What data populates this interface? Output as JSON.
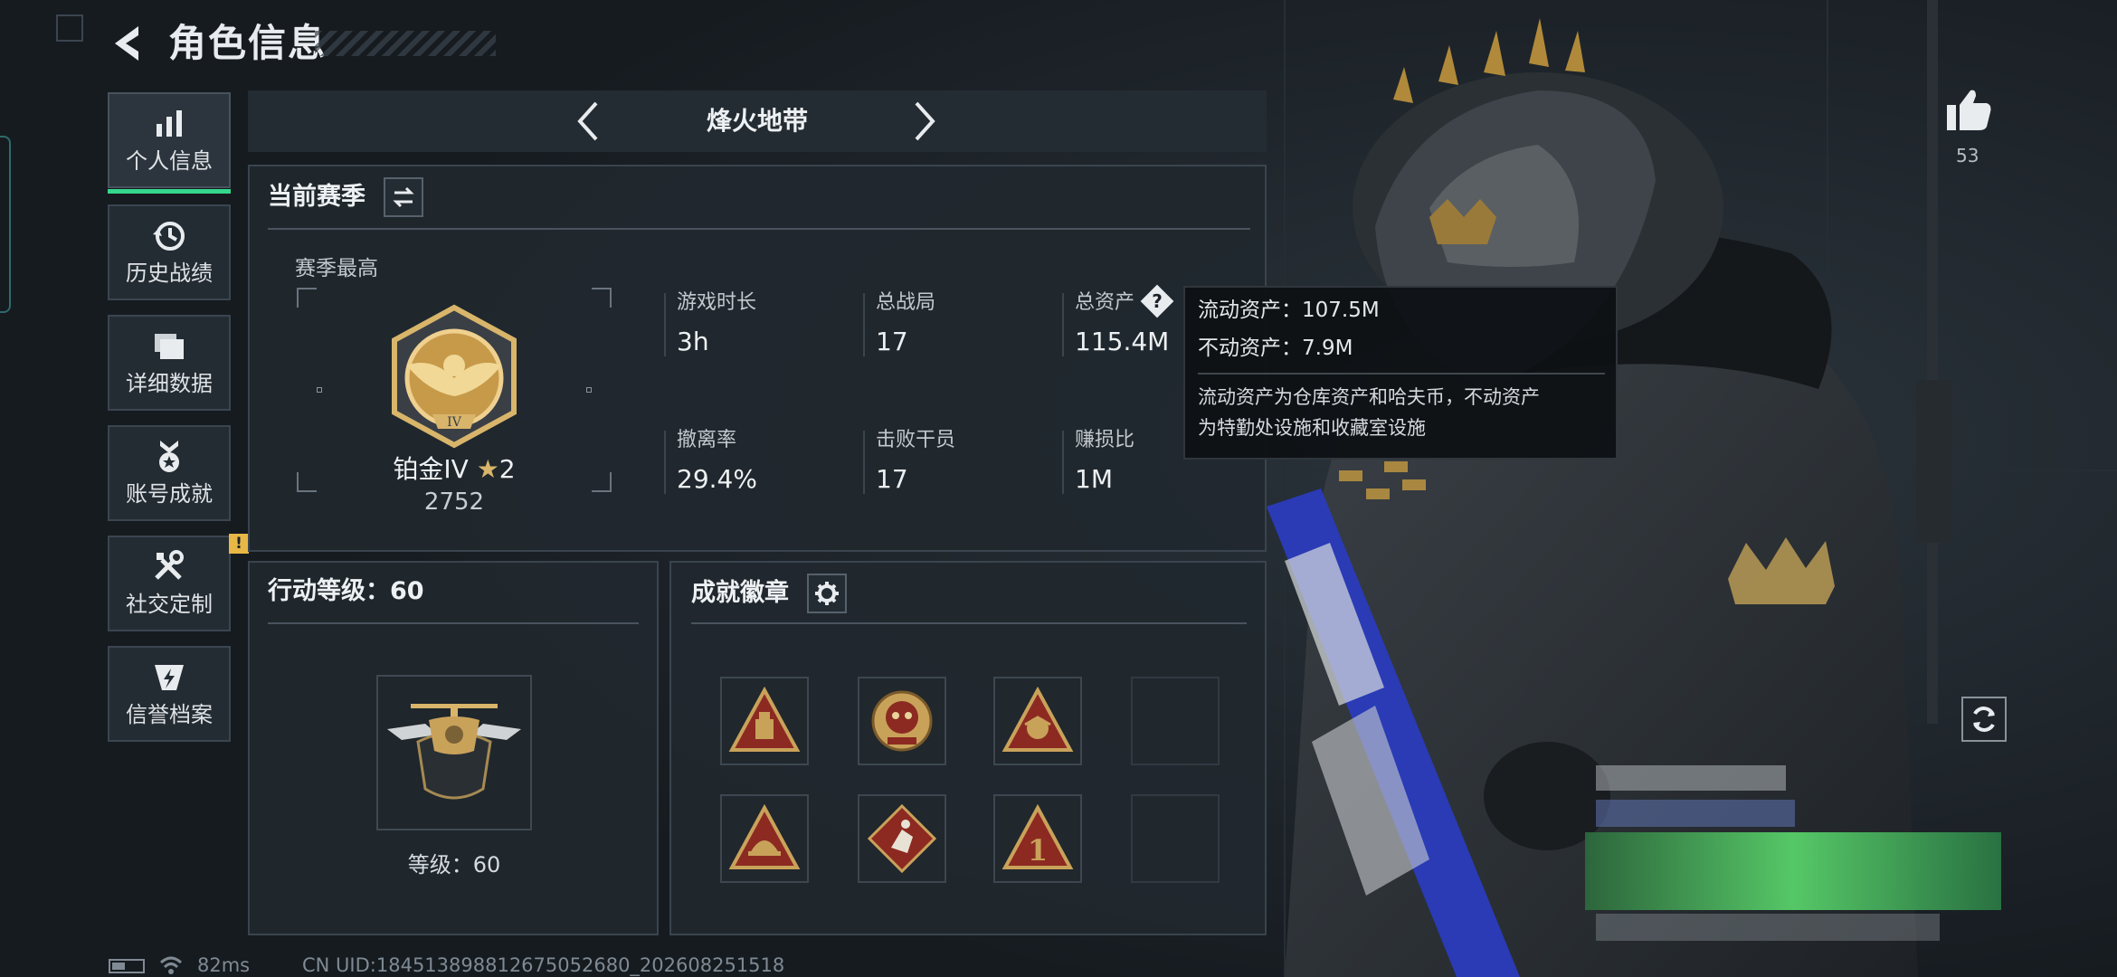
{
  "header": {
    "title": "角色信息"
  },
  "sidebar": {
    "items": [
      {
        "label": "个人信息",
        "icon": "bar-chart-icon",
        "active": true
      },
      {
        "label": "历史战绩",
        "icon": "history-clock-icon"
      },
      {
        "label": "详细数据",
        "icon": "folder-stack-icon"
      },
      {
        "label": "账号成就",
        "icon": "medal-icon"
      },
      {
        "label": "社交定制",
        "icon": "tools-icon",
        "badge": "!"
      },
      {
        "label": "信誉档案",
        "icon": "shield-lightning-icon"
      }
    ]
  },
  "mode": {
    "title": "烽火地带"
  },
  "season": {
    "title": "当前赛季",
    "peak_label": "赛季最高",
    "rank_name": "铂金IV",
    "rank_stars": "2",
    "rank_score": "2752",
    "rank_numeral": "IV",
    "stats": [
      {
        "label": "游戏时长",
        "value": "3h"
      },
      {
        "label": "总战局",
        "value": "17"
      },
      {
        "label": "总资产",
        "value": "115.4M"
      },
      {
        "label": "撤离率",
        "value": "29.4%"
      },
      {
        "label": "击败干员",
        "value": "17"
      },
      {
        "label": "赚损比",
        "value": "1M"
      }
    ]
  },
  "tooltip": {
    "liquid": "流动资产：107.5M",
    "fixed": "不动资产：7.9M",
    "note_line1": "流动资产为仓库资产和哈夫币，不动资产",
    "note_line2": "为特勤处设施和收藏室设施"
  },
  "action_level": {
    "title": "行动等级：60",
    "level_text": "等级：60"
  },
  "badges": {
    "title": "成就徽章"
  },
  "likes": {
    "count": "53"
  },
  "status": {
    "ping": "82ms",
    "uid": "CN UID:184513898812675052680_202608251518"
  },
  "colors": {
    "accent_green": "#35d78b",
    "badge_yellow": "#e8b846",
    "badge_red": "#8c2a22",
    "gold": "#c9a25a"
  }
}
